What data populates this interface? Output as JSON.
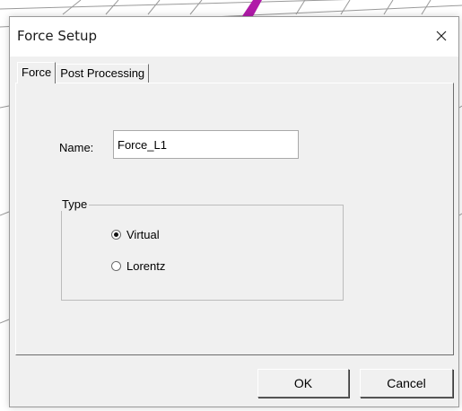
{
  "window": {
    "title": "Force Setup",
    "close_icon": "close-icon"
  },
  "tabs": [
    {
      "label": "Force",
      "active": true
    },
    {
      "label": "Post Processing",
      "active": false
    }
  ],
  "form": {
    "name_label": "Name:",
    "name_value": "Force_L1"
  },
  "type_group": {
    "legend": "Type",
    "options": [
      {
        "label": "Virtual",
        "selected": true
      },
      {
        "label": "Lorentz",
        "selected": false
      }
    ]
  },
  "buttons": {
    "ok_label": "OK",
    "cancel_label": "Cancel"
  },
  "colors": {
    "background_stroke": "#b01aa8",
    "dialog_bg": "#f0f0f0"
  }
}
